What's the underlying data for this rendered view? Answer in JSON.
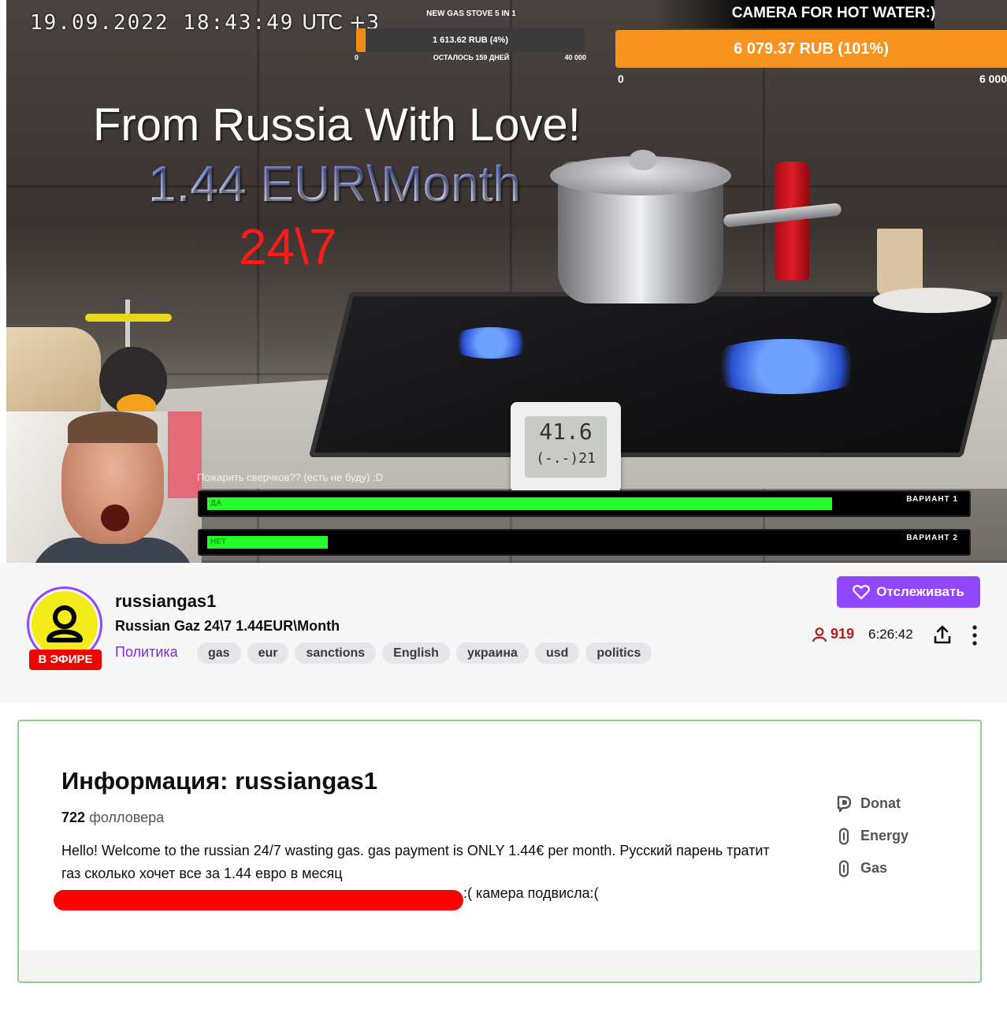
{
  "stream": {
    "timestamp": "19.09.2022 18:43:49",
    "timezone": "UTC +3",
    "goal_small": {
      "title": "NEW GAS STOVE 5 IN 1",
      "value": "1 613.62 RUB (4%)",
      "progress_percent": 4,
      "remaining": "ОСТАЛОСЬ 159 ДНЕЙ",
      "min": "0",
      "max": "40 000"
    },
    "goal_big": {
      "title": "CAMERA FOR HOT WATER:)",
      "value": "6 079.37 RUB (101%)",
      "progress_percent": 101,
      "min": "0",
      "max": "6 000"
    },
    "overlay": {
      "line1": "From Russia With Love!",
      "line2": "1.44 EUR\\Month",
      "line3": "24\\7"
    },
    "thermometer": {
      "temp": "41.6",
      "humidity": "(-.-)21"
    },
    "poll": {
      "question": "Пожарить сверчков?? (есть не буду) :D",
      "options": [
        {
          "label": "ДА",
          "option": "ВАРИАНТ 1",
          "fraction": 0.83
        },
        {
          "label": "НЕТ",
          "option": "ВАРИАНТ 2",
          "fraction": 0.16
        }
      ]
    }
  },
  "channel": {
    "name": "russiangas1",
    "live_badge": "В ЭФИРЕ",
    "title": "Russian Gaz 24\\7 1.44EUR\\Month",
    "category": "Политика",
    "tags": [
      "gas",
      "eur",
      "sanctions",
      "English",
      "украина",
      "usd",
      "politics"
    ],
    "follow_label": "Отслеживать",
    "viewers": "919",
    "uptime": "6:26:42"
  },
  "about": {
    "title": "Информация: russiangas1",
    "followers_count": "722",
    "followers_label": "фолловера",
    "description": "Hello! Welcome to the russian 24/7 wasting gas. gas payment is ONLY 1.44€ per month. Русский парень тратит газ сколько хочет все за 1.44 евро в месяц",
    "camera_note": ":( камера подвисла:(",
    "links": [
      {
        "label": "Donat",
        "icon": "donationalerts-icon"
      },
      {
        "label": "Energy",
        "icon": "link-icon"
      },
      {
        "label": "Gas",
        "icon": "link-icon"
      }
    ]
  },
  "colors": {
    "accent": "#9147ff",
    "live": "#eb0400",
    "goal": "#f7931e",
    "poll_fill": "#22ff2a"
  }
}
